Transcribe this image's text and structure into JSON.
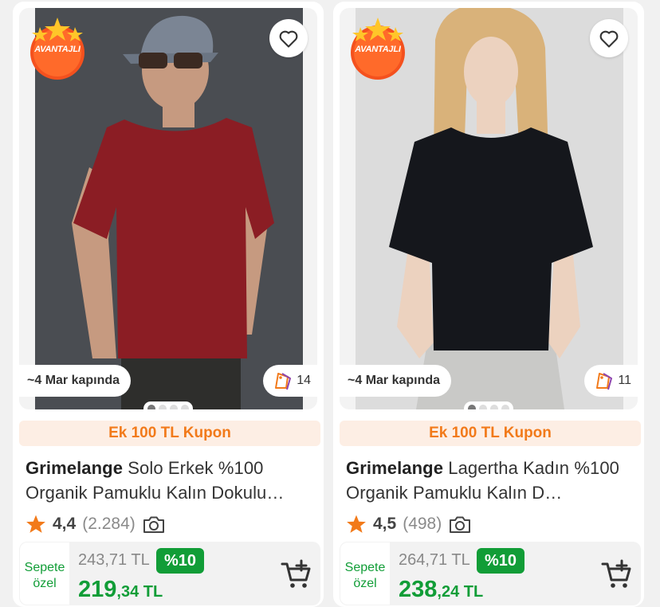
{
  "products": [
    {
      "badge": "AVANTAJLI",
      "delivery": "~4 Mar kapında",
      "collection_count": "14",
      "coupon": "Ek 100 TL Kupon",
      "brand": "Grimelange",
      "name": " Solo Erkek %100 Organik Pamuklu Kalın Dokulu…",
      "rating": "4,4",
      "review_count": "(2.284)",
      "sepete_label_1": "Sepete",
      "sepete_label_2": "özel",
      "old_price": "243,71 TL",
      "discount": "%10",
      "price_int": "219",
      "price_dec": ",34 TL",
      "shirt_color": "#8b1d24",
      "bg_color": "#4a4d52"
    },
    {
      "badge": "AVANTAJLI",
      "delivery": "~4 Mar kapında",
      "collection_count": "11",
      "coupon": "Ek 100 TL Kupon",
      "brand": "Grimelange",
      "name": " Lagertha Kadın %100 Organik Pamuklu Kalın D…",
      "rating": "4,5",
      "review_count": "(498)",
      "sepete_label_1": "Sepete",
      "sepete_label_2": "özel",
      "old_price": "264,71 TL",
      "discount": "%10",
      "price_int": "238",
      "price_dec": ",24 TL",
      "shirt_color": "#15171c",
      "bg_color": "#dcdcdc"
    }
  ],
  "colors": {
    "accent_orange": "#f27a1a",
    "coupon_bg": "#fdeee4",
    "price_green": "#119d37"
  }
}
